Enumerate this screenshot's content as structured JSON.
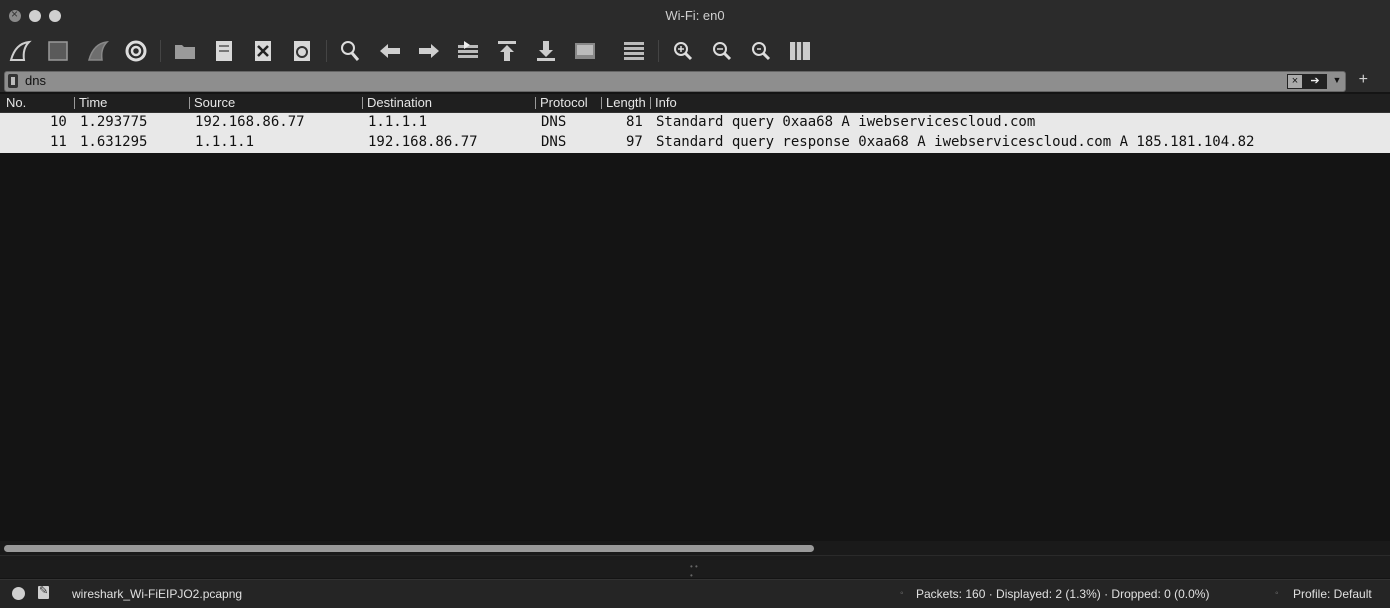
{
  "window": {
    "title": "Wi-Fi: en0"
  },
  "toolbar": {
    "buttons": [
      {
        "icon": "shark-fin-start-icon"
      },
      {
        "icon": "stop-square-icon"
      },
      {
        "icon": "shark-fin-restart-icon"
      },
      {
        "icon": "capture-options-gear-icon"
      },
      {
        "icon": "open-folder-icon"
      },
      {
        "icon": "save-file-icon"
      },
      {
        "icon": "close-file-icon"
      },
      {
        "icon": "reload-file-icon"
      },
      {
        "icon": "find-packet-icon"
      },
      {
        "icon": "go-back-arrow-icon"
      },
      {
        "icon": "go-forward-arrow-icon"
      },
      {
        "icon": "go-to-packet-icon"
      },
      {
        "icon": "go-first-packet-icon"
      },
      {
        "icon": "go-last-packet-icon"
      },
      {
        "icon": "auto-scroll-icon"
      },
      {
        "icon": "colorize-icon"
      },
      {
        "icon": "zoom-in-icon"
      },
      {
        "icon": "zoom-out-icon"
      },
      {
        "icon": "normal-size-icon"
      },
      {
        "icon": "resize-columns-icon"
      }
    ]
  },
  "filter": {
    "value": "dns",
    "plus": "+"
  },
  "columns": [
    "No.",
    "Time",
    "Source",
    "Destination",
    "Protocol",
    "Length",
    "Info"
  ],
  "packets": [
    {
      "no": "10",
      "time": "1.293775",
      "source": "192.168.86.77",
      "destination": "1.1.1.1",
      "protocol": "DNS",
      "length": "81",
      "info": "Standard query 0xaa68 A iwebservicescloud.com"
    },
    {
      "no": "11",
      "time": "1.631295",
      "source": "1.1.1.1",
      "destination": "192.168.86.77",
      "protocol": "DNS",
      "length": "97",
      "info": "Standard query response 0xaa68 A iwebservicescloud.com A 185.181.104.82"
    }
  ],
  "status": {
    "file": "wireshark_Wi-FiEIPJO2.pcapng",
    "packets": "Packets: 160 · Displayed: 2 (1.3%) · Dropped: 0 (0.0%)",
    "profile": "Profile: Default"
  },
  "colors": {
    "row_bg": "#e8e8e8",
    "bg": "#141414",
    "chrome": "#2b2b2b"
  }
}
